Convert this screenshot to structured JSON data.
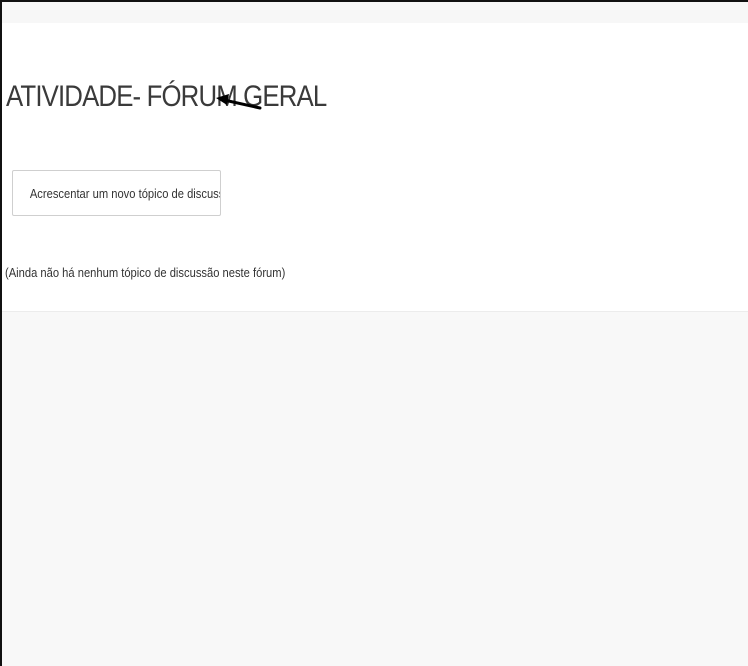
{
  "forum": {
    "title": "ATIVIDADE- FÓRUM GERAL",
    "add_topic_label": "Acrescentar um novo tópico de discussão",
    "empty_message": "(Ainda não há nenhum tópico de discussão neste fórum)"
  },
  "colors": {
    "page_background": "#f8f8f8",
    "card_background": "#ffffff",
    "text": "#333333",
    "button_border": "#cfcfcf",
    "annotation_arrow": "#000000"
  },
  "icons": {
    "annotation": "arrow-left-icon"
  }
}
